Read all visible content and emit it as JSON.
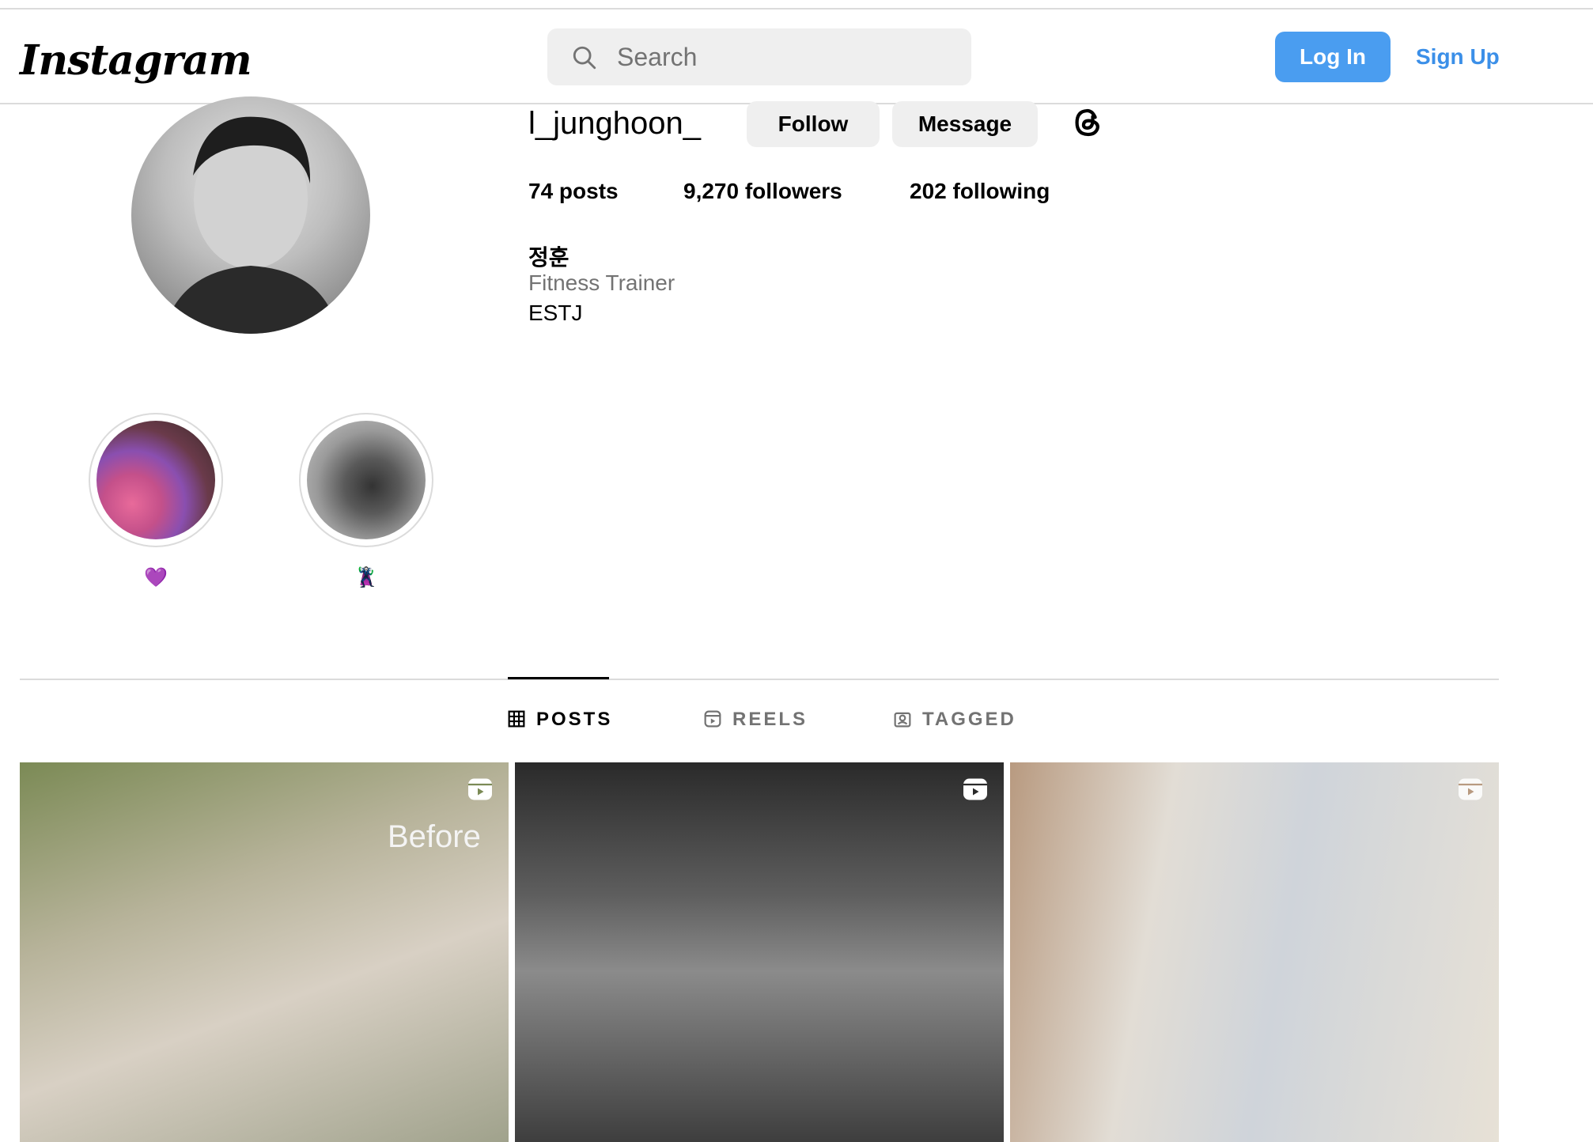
{
  "header": {
    "logo_text": "Instagram",
    "search_placeholder": "Search",
    "login_label": "Log In",
    "signup_label": "Sign Up"
  },
  "profile": {
    "username": "l_junghoon_",
    "follow_label": "Follow",
    "message_label": "Message",
    "stats": {
      "posts": "74 posts",
      "followers": "9,270 followers",
      "following": "202 following"
    },
    "bio": {
      "name": "정훈",
      "category": "Fitness Trainer",
      "text": "ESTJ"
    }
  },
  "highlights": [
    {
      "label": "💜"
    },
    {
      "label": "🦹"
    }
  ],
  "tabs": [
    {
      "label": "POSTS",
      "icon": "grid-icon",
      "active": true
    },
    {
      "label": "REELS",
      "icon": "reels-icon",
      "active": false
    },
    {
      "label": "TAGGED",
      "icon": "tagged-icon",
      "active": false
    }
  ],
  "posts": [
    {
      "overlay_text": "Before",
      "icon": "reel-icon"
    },
    {
      "overlay_text": "",
      "icon": "reel-icon"
    },
    {
      "overlay_text": "",
      "icon": "reel-icon"
    }
  ],
  "colors": {
    "accent": "#4a9df0",
    "link": "#3b8fe8",
    "button_gray": "#efefef",
    "muted_text": "#737373",
    "divider": "#dbdbdb"
  }
}
